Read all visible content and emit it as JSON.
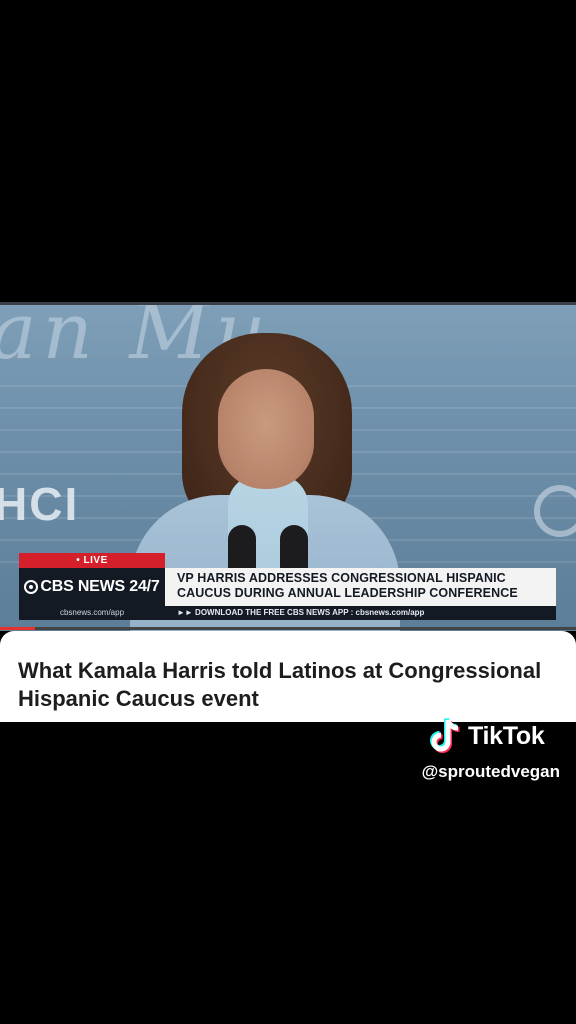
{
  "video": {
    "backdrop_text": "HCI",
    "live_label": "• LIVE",
    "brand": "CBS NEWS 24/7",
    "headline_line1": "VP HARRIS ADDRESSES CONGRESSIONAL HISPANIC",
    "headline_line2": "CAUCUS DURING ANNUAL LEADERSHIP CONFERENCE",
    "brand_url": "cbsnews.com/app",
    "ticker": "►► DOWNLOAD THE FREE CBS NEWS APP : cbsnews.com/app",
    "progress_fraction": 0.06
  },
  "caption": {
    "title": "What Kamala Harris told Latinos at Congressional Hispanic Caucus event"
  },
  "watermark": {
    "app_name": "TikTok",
    "handle": "@sproutedvegan",
    "icon": "tiktok-note-icon"
  },
  "colors": {
    "live_red": "#d51f2b",
    "brand_navy": "#141a24",
    "progress_red": "#e6312f"
  }
}
